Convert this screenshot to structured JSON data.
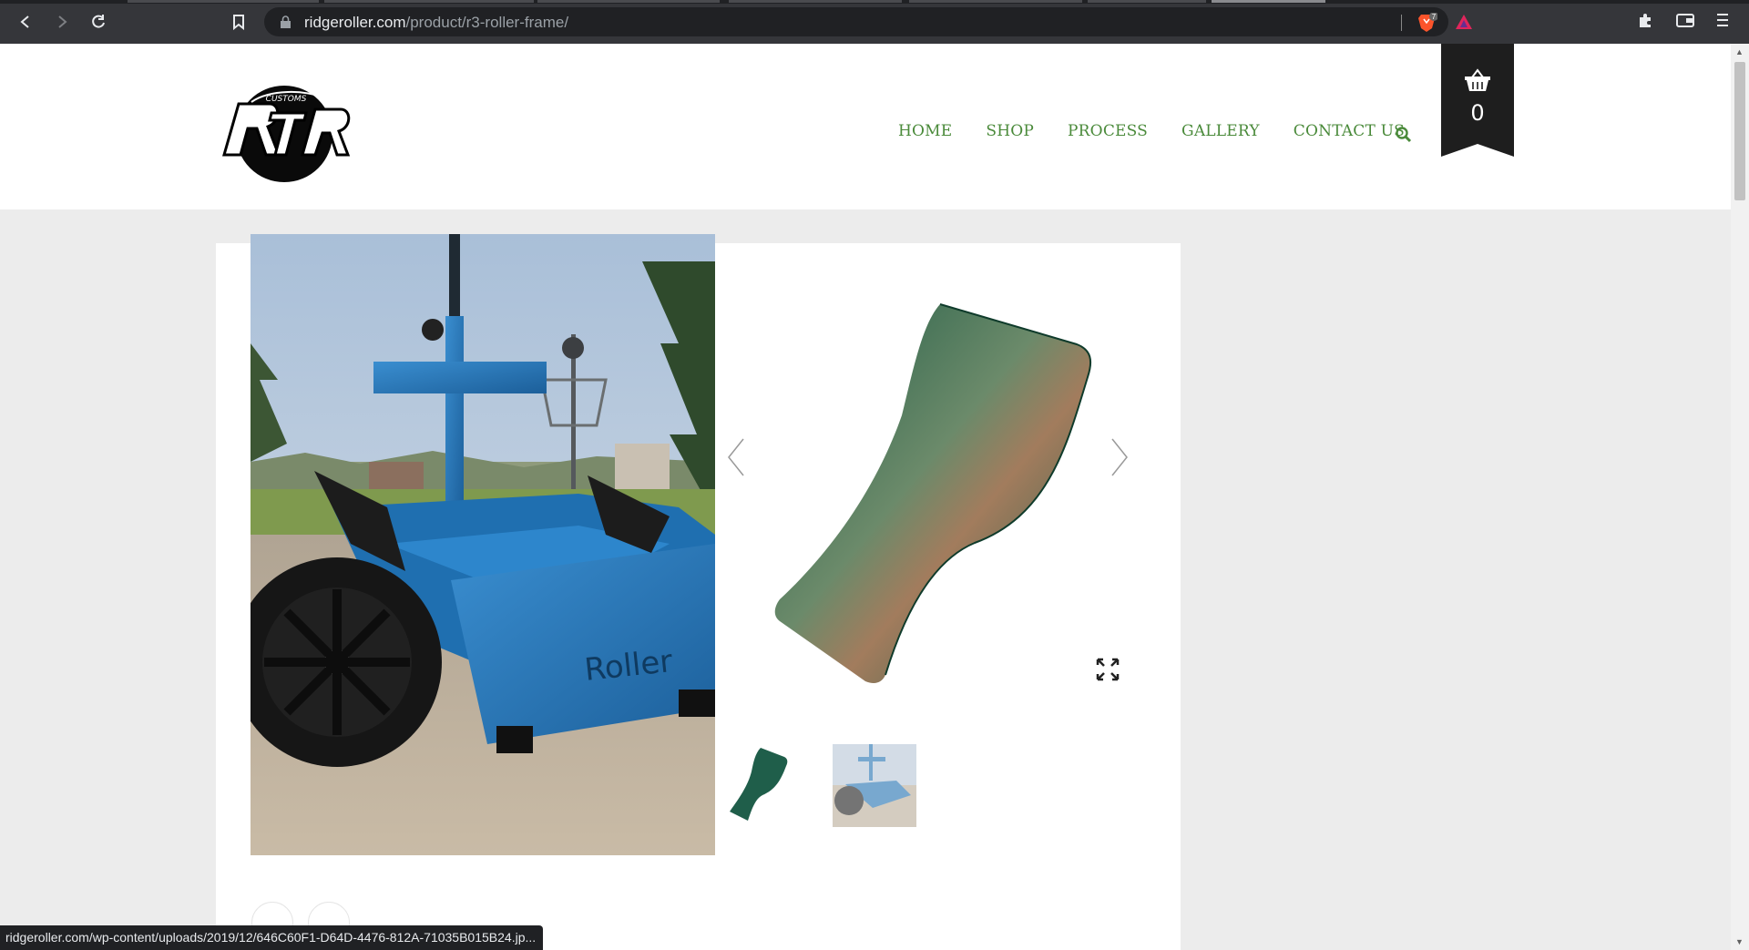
{
  "browser": {
    "url_host": "ridgeroller.com",
    "url_path": "/product/r3-roller-frame/",
    "brave_badge": "7",
    "status_url": "ridgeroller.com/wp-content/uploads/2019/12/646C60F1-D64D-4476-812A-71035B015B24.jp..."
  },
  "header": {
    "logo_text": "RTR",
    "logo_subtext": "CUSTOMS",
    "nav": [
      "HOME",
      "SHOP",
      "PROCESS",
      "GALLERY",
      "CONTACT US"
    ],
    "cart_count": "0"
  },
  "product": {
    "main_image": "roller-cart-photo",
    "cart_stencil": "Roller",
    "gallery_image": "powder-coat-swatch-green",
    "thumbnails": [
      "powder-coat-swatch-green",
      "roller-cart-photo"
    ]
  },
  "colors": {
    "nav_green": "#4a8a3a",
    "cart_blue": "#2a74b4",
    "swatch_green": "#1f5e4a",
    "ribbon": "#1e1e1e"
  }
}
